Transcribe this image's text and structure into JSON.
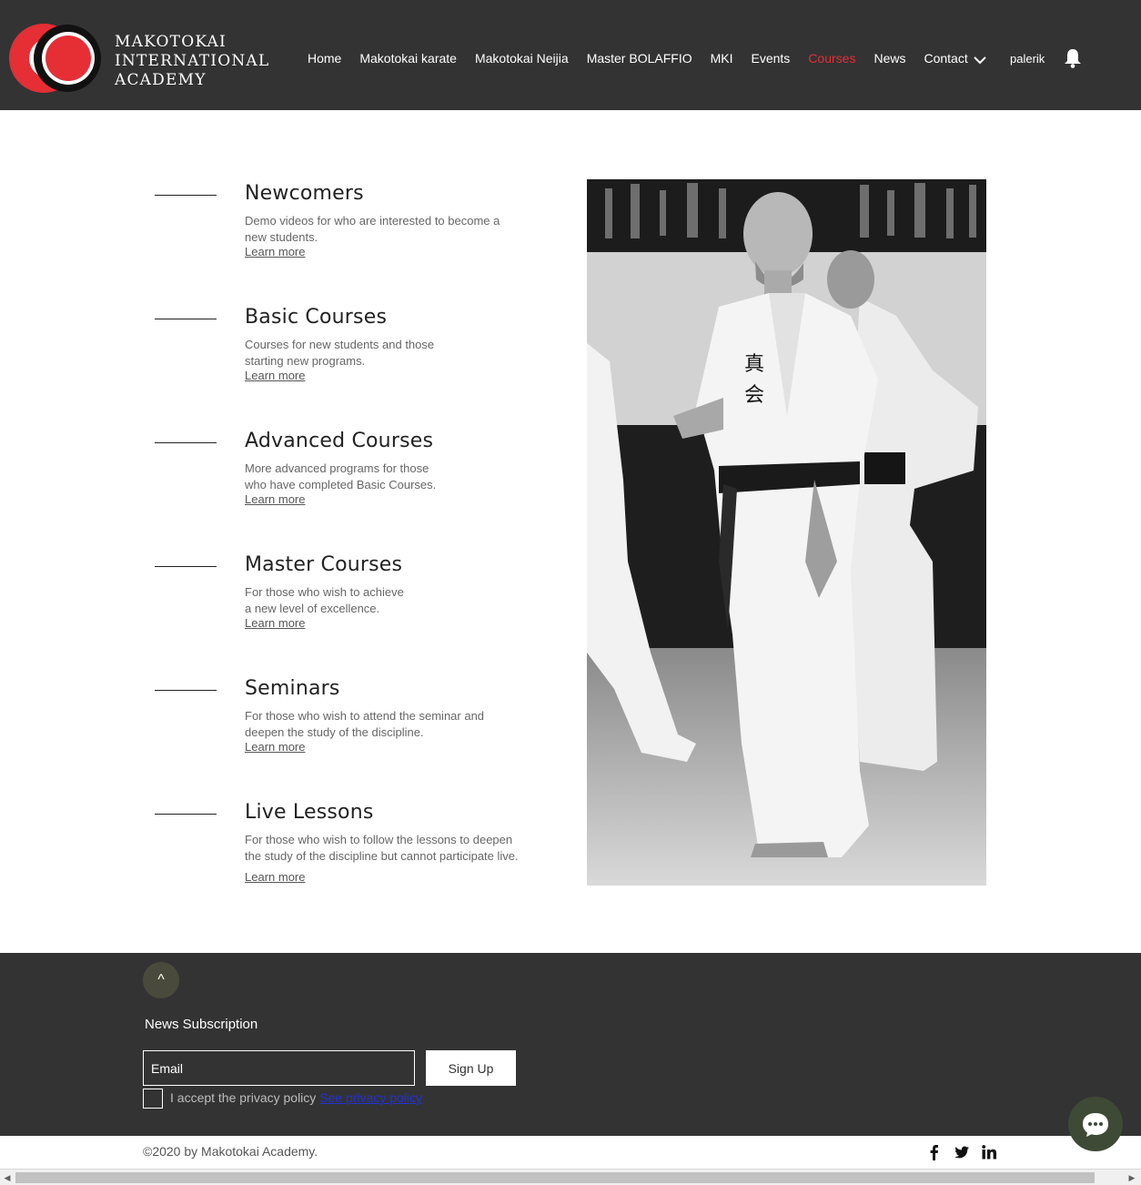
{
  "brand": {
    "line1": "MAKOTOKAI",
    "line2": "INTERNATIONAL",
    "line3": "ACADEMY",
    "colors": {
      "red": "#e62e35",
      "dark": "#333333",
      "black": "#111111"
    }
  },
  "nav": {
    "items": [
      {
        "label": "Home",
        "active": false
      },
      {
        "label": "Makotokai karate",
        "active": false
      },
      {
        "label": "Makotokai Neijia",
        "active": false
      },
      {
        "label": "Master BOLAFFIO",
        "active": false
      },
      {
        "label": "MKI",
        "active": false
      },
      {
        "label": "Events",
        "active": false
      },
      {
        "label": "Courses",
        "active": true
      },
      {
        "label": "News",
        "active": false
      },
      {
        "label": "Contact",
        "active": false
      }
    ],
    "more_icon": "chevron-down-icon",
    "user": "palerik",
    "notification_icon": "bell-icon"
  },
  "courses": [
    {
      "title": "Newcomers",
      "desc_line1": "Demo videos for who are interested to become a",
      "desc_line2": "new students.",
      "link": "Learn more"
    },
    {
      "title": "Basic Courses",
      "desc_line1": "Courses for new students and those",
      "desc_line2": "starting new programs.",
      "link": "Learn more"
    },
    {
      "title": "Advanced Courses",
      "desc_line1": "More advanced programs for those",
      "desc_line2": "who have completed Basic Courses.",
      "link": "Learn more"
    },
    {
      "title": "Master Courses",
      "desc_line1": "For those who wish to achieve",
      "desc_line2": "a new level of excellence.",
      "link": "Learn more"
    },
    {
      "title": "Seminars",
      "desc_line1": "For those who wish to attend the seminar and",
      "desc_line2": "deepen the study of the discipline.",
      "link": "Learn more"
    },
    {
      "title": "Live Lessons",
      "desc_line1": "For those who wish to follow the lessons to deepen",
      "desc_line2": "the study of the discipline but cannot participate live.",
      "link": "Learn more"
    }
  ],
  "photo": {
    "kanji": "真会"
  },
  "footer": {
    "back_to_top": "^",
    "subscription_title": "News Subscription",
    "email_placeholder": "Email",
    "signup_label": "Sign Up",
    "privacy_text": "I accept the privacy policy",
    "privacy_link": "See privacy policy",
    "copyright": "©2020 by Makotokai Academy.",
    "social": [
      "facebook-icon",
      "twitter-icon",
      "linkedin-icon"
    ]
  }
}
